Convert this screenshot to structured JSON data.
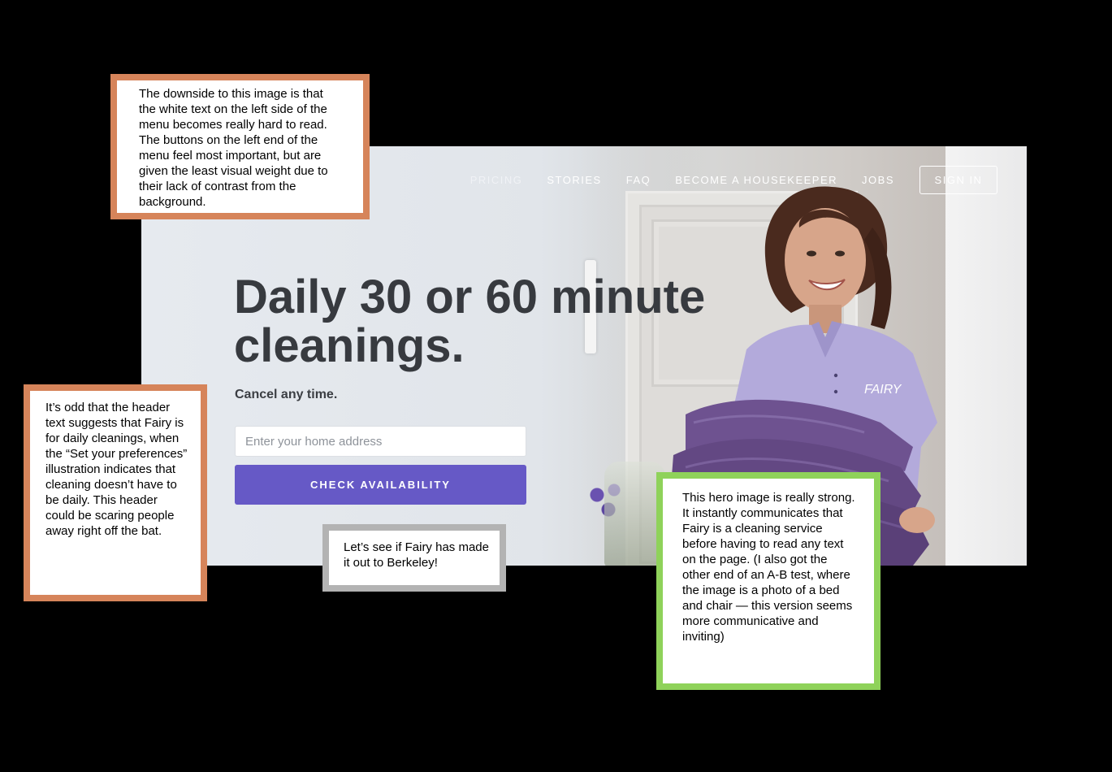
{
  "nav": {
    "items": [
      "PRICING",
      "STORIES",
      "FAQ",
      "BECOME A HOUSEKEEPER",
      "JOBS"
    ],
    "sign_in": "SIGN IN"
  },
  "hero": {
    "headline": "Daily 30 or 60 minute cleanings.",
    "subhead": "Cancel any time.",
    "address_placeholder": "Enter your home address",
    "cta": "CHECK AVAILABILITY",
    "shirt_logo": "FAIRY"
  },
  "notes": {
    "menu_contrast": "The downside to this image is that the white text on the left side of the menu becomes really hard to read. The buttons on the left end of the menu feel most important, but are given the least visual weight due to their lack of contrast from the background.",
    "header_text": "It’s odd that the header text suggests that Fairy is for daily cleanings, when the “Set your preferences” illustration indicates that cleaning doesn’t have to be daily. This header could be scaring people away right off the bat.",
    "berkeley": "Let’s see if Fairy has made it out to Berkeley!",
    "hero_image": "This hero image is really strong. It instantly communicates that Fairy is a cleaning service before having to read any text on the page. (I also got the other end of an A-B test, where the image is a photo of a bed and chair — this version seems more communicative and inviting)"
  },
  "colors": {
    "orange_border": "#d6845a",
    "green_border": "#8fd25a",
    "gray_border": "#b3b3b3",
    "cta_purple": "#6659c6",
    "headline_text": "#373a3f"
  }
}
